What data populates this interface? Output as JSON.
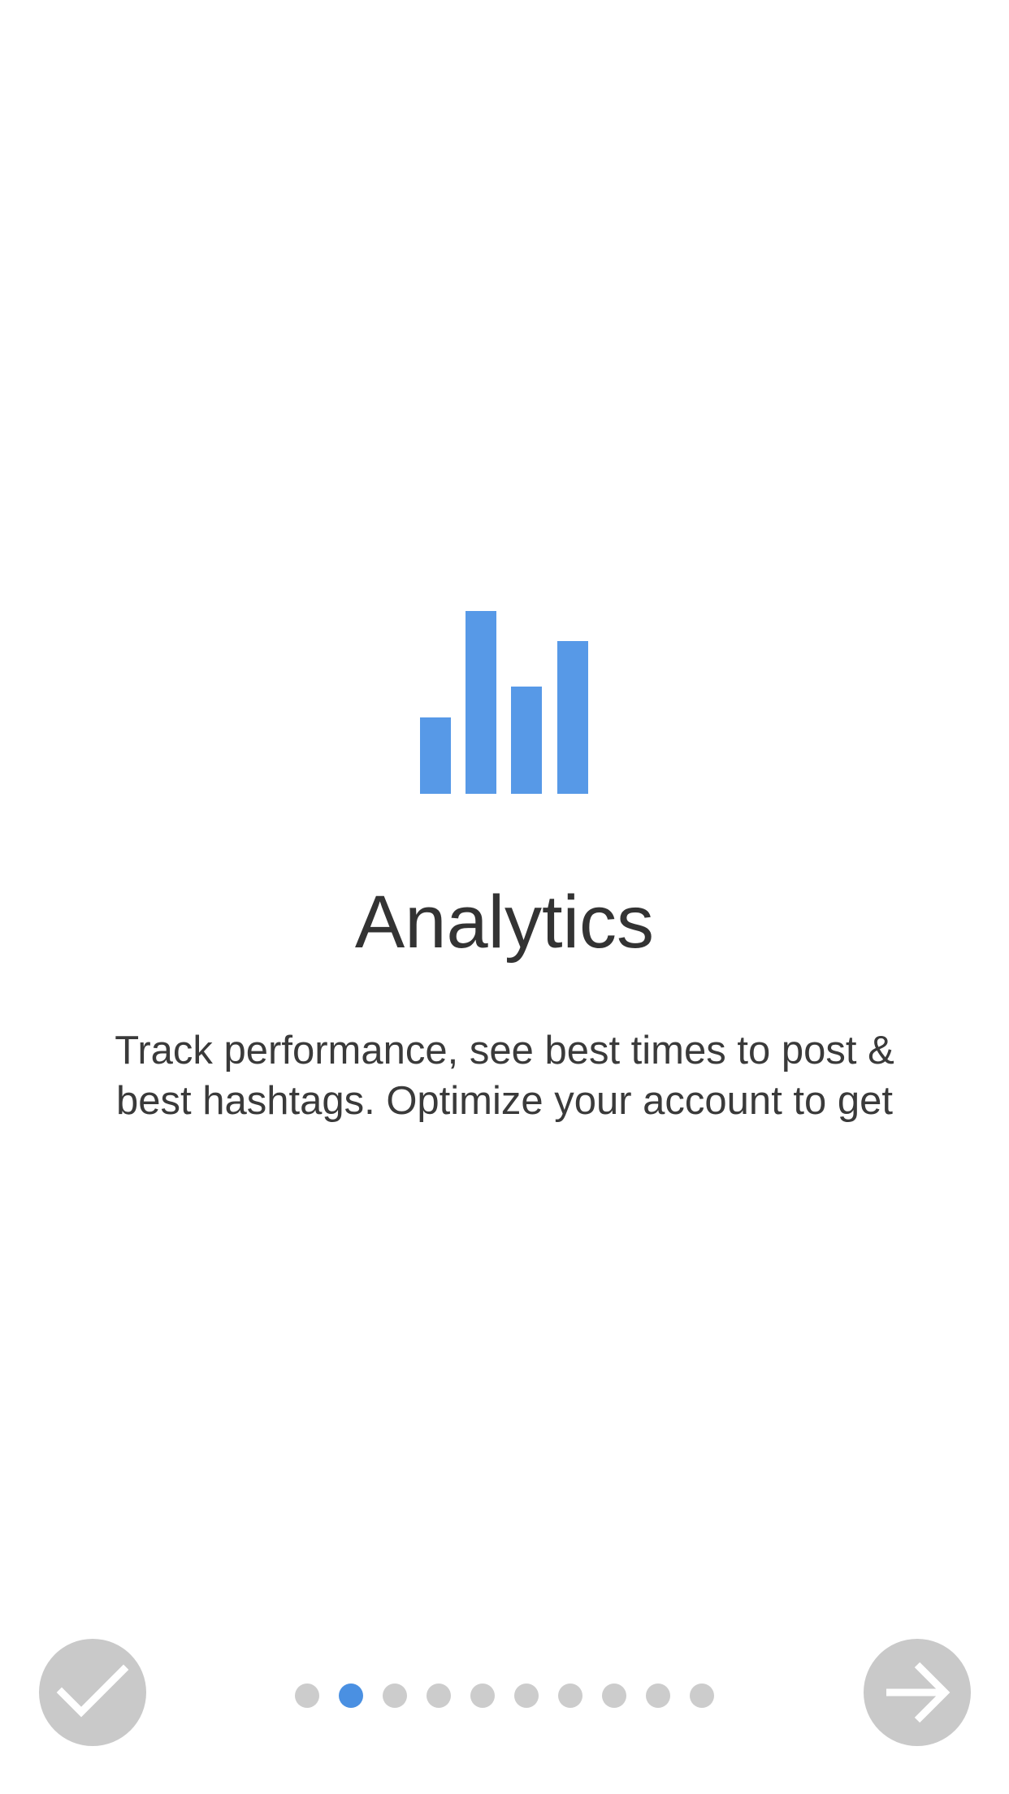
{
  "onboarding": {
    "title": "Analytics",
    "description": "Track performance, see best times to post & best hashtags. Optimize your account to get",
    "icon": "bar-chart-icon",
    "accent_color": "#5799e7",
    "pager": {
      "total_pages": 10,
      "current_page": 2,
      "active_color": "#4a90e2",
      "inactive_color": "#cccccc"
    },
    "done_button_icon": "checkmark-icon",
    "next_button_icon": "arrow-right-icon"
  }
}
